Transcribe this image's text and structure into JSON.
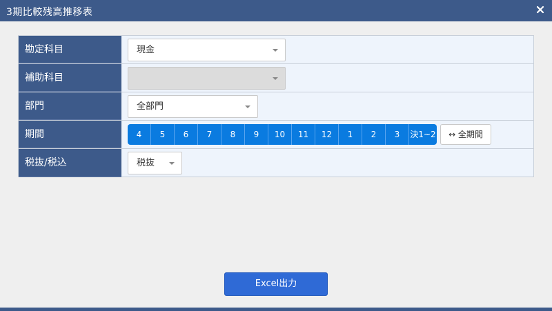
{
  "window": {
    "title": "3期比較残高推移表"
  },
  "form": {
    "account": {
      "label": "勘定科目",
      "value": "現金"
    },
    "subaccount": {
      "label": "補助科目",
      "value": ""
    },
    "department": {
      "label": "部門",
      "value": "全部門"
    },
    "period": {
      "label": "期間",
      "months": [
        "4",
        "5",
        "6",
        "7",
        "8",
        "9",
        "10",
        "11",
        "12",
        "1",
        "2",
        "3",
        "決1~2"
      ],
      "all_label": "↔ 全期間"
    },
    "tax": {
      "label": "税抜/税込",
      "value": "税抜"
    }
  },
  "footer": {
    "excel_label": "Excel出力"
  },
  "colors": {
    "header": "#3d5a8a",
    "period_selected": "#0a7be0",
    "excel_button": "#2f6ad6"
  }
}
